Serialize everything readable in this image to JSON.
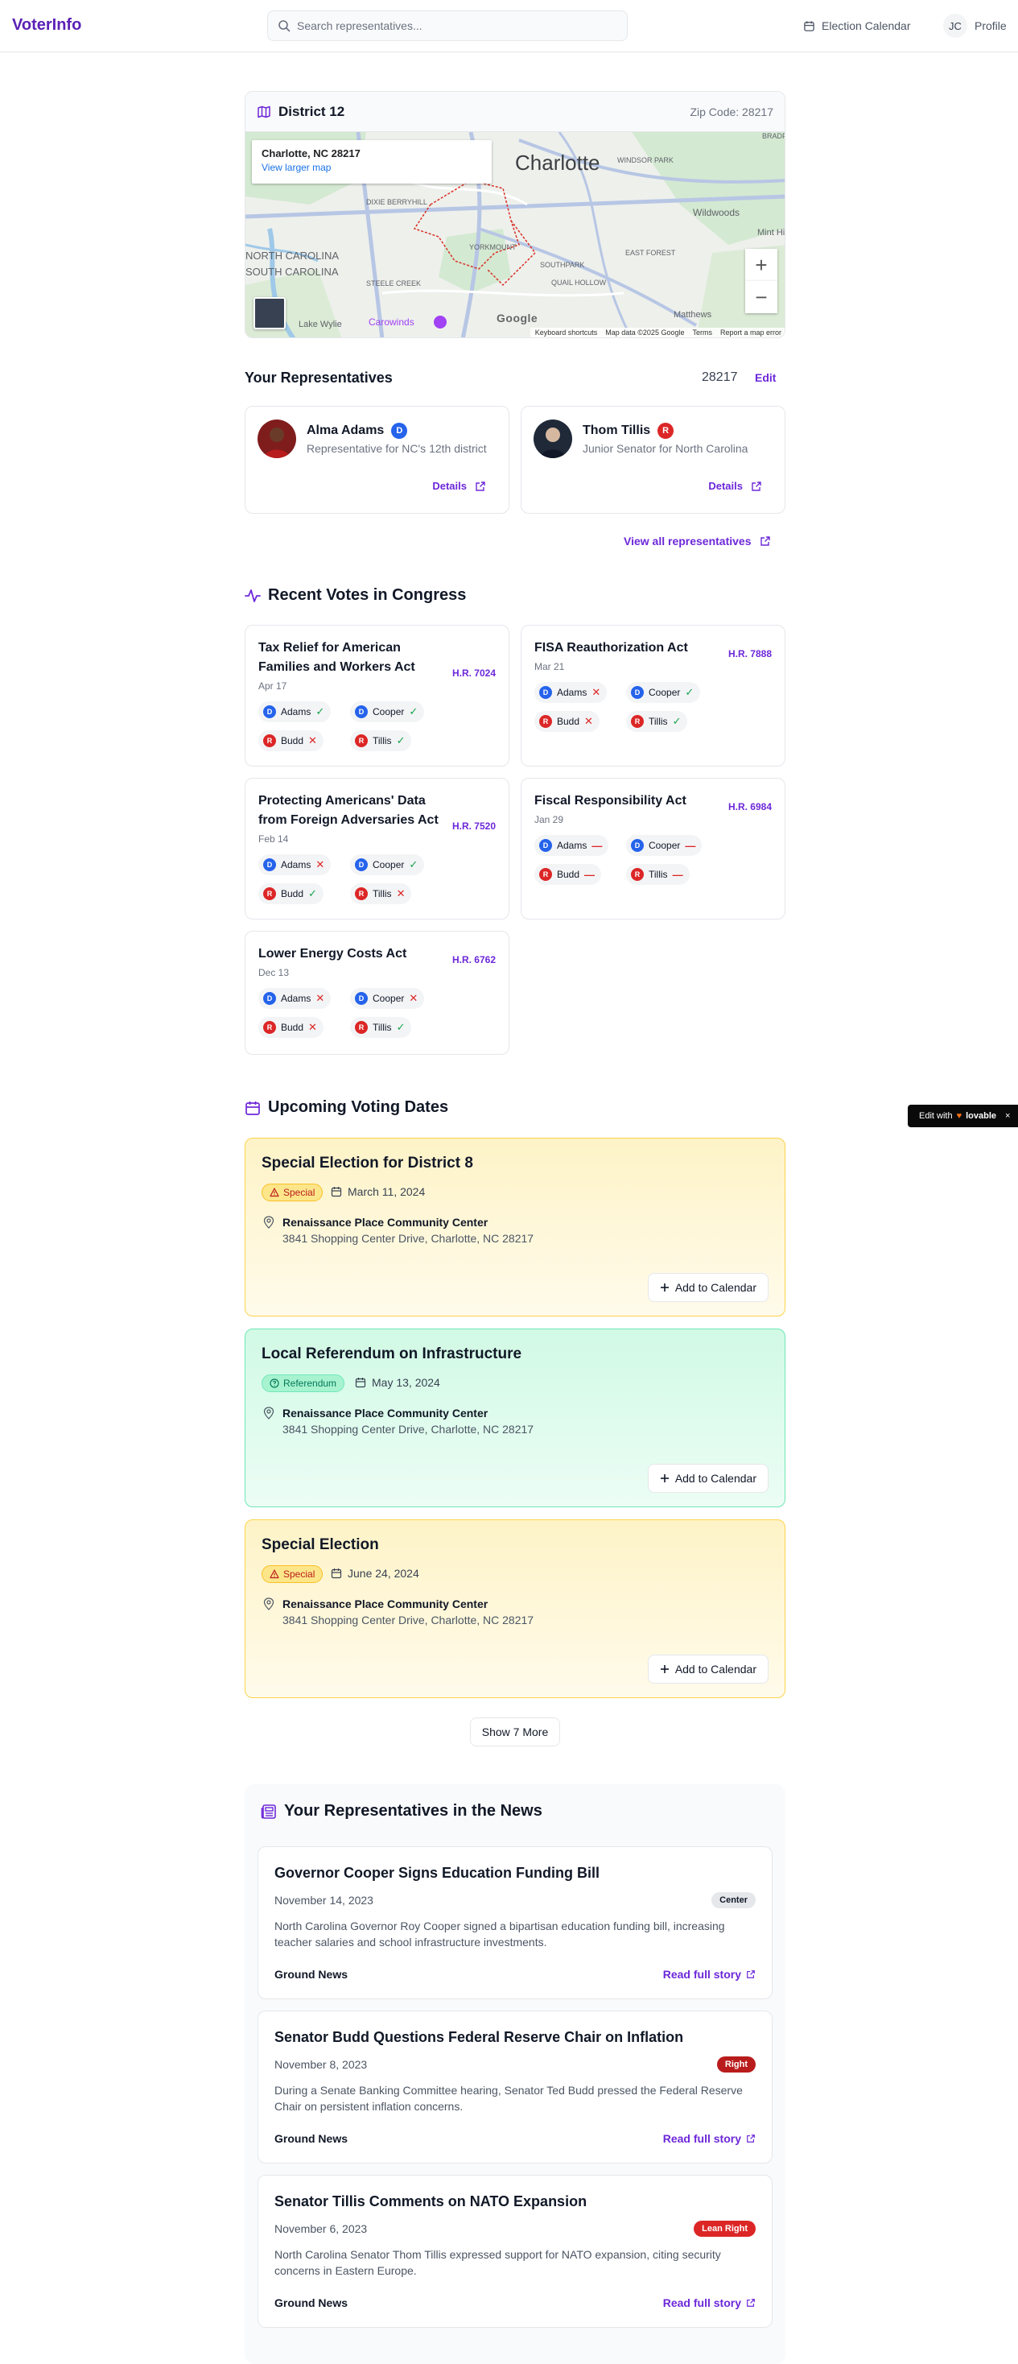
{
  "header": {
    "logo": "VoterInfo",
    "search_placeholder": "Search representatives...",
    "calendar_label": "Election Calendar",
    "profile_initials": "JC",
    "profile_label": "Profile"
  },
  "district": {
    "title": "District 12",
    "zip_label": "Zip Code: 28217",
    "map": {
      "info_title": "Charlotte, NC 28217",
      "info_link": "View larger map",
      "city_label": "Charlotte",
      "place_labels": [
        "WINDSOR PARK",
        "DIXIE BERRYHILL",
        "Wildwoods",
        "YORKMOUNT",
        "EAST FOREST",
        "SOUTHPARK",
        "QUAIL HOLLOW",
        "STEELE CREEK",
        "Matthews",
        "Lake Wylie",
        "Carowinds",
        "NORTH CAROLINA",
        "SOUTH CAROLINA",
        "Mint Hill",
        "BRADF"
      ],
      "zoom_in": "+",
      "zoom_out": "−",
      "attribution": [
        "Keyboard shortcuts",
        "Map data ©2025 Google",
        "Terms",
        "Report a map error"
      ],
      "google_label": "Google"
    }
  },
  "representatives": {
    "title": "Your Representatives",
    "zip": "28217",
    "edit_label": "Edit",
    "items": [
      {
        "name": "Alma Adams",
        "party": "D",
        "role": "Representative for NC's 12th district",
        "details_label": "Details"
      },
      {
        "name": "Thom Tillis",
        "party": "R",
        "role": "Junior Senator for North Carolina",
        "details_label": "Details"
      }
    ],
    "view_all_label": "View all representatives"
  },
  "votes": {
    "title": "Recent Votes in Congress",
    "items": [
      {
        "title": "Tax Relief for American Families and Workers Act",
        "date": "Apr 17",
        "bill": "H.R. 7024",
        "members": [
          {
            "party": "D",
            "name": "Adams",
            "vote": "yes"
          },
          {
            "party": "D",
            "name": "Cooper",
            "vote": "yes"
          },
          {
            "party": "R",
            "name": "Budd",
            "vote": "no"
          },
          {
            "party": "R",
            "name": "Tillis",
            "vote": "yes"
          }
        ]
      },
      {
        "title": "FISA Reauthorization Act",
        "date": "Mar 21",
        "bill": "H.R. 7888",
        "members": [
          {
            "party": "D",
            "name": "Adams",
            "vote": "no"
          },
          {
            "party": "D",
            "name": "Cooper",
            "vote": "yes"
          },
          {
            "party": "R",
            "name": "Budd",
            "vote": "no"
          },
          {
            "party": "R",
            "name": "Tillis",
            "vote": "yes"
          }
        ]
      },
      {
        "title": "Protecting Americans' Data from Foreign Adversaries Act",
        "date": "Feb 14",
        "bill": "H.R. 7520",
        "members": [
          {
            "party": "D",
            "name": "Adams",
            "vote": "no"
          },
          {
            "party": "D",
            "name": "Cooper",
            "vote": "yes"
          },
          {
            "party": "R",
            "name": "Budd",
            "vote": "yes"
          },
          {
            "party": "R",
            "name": "Tillis",
            "vote": "no"
          }
        ]
      },
      {
        "title": "Fiscal Responsibility Act",
        "date": "Jan 29",
        "bill": "H.R. 6984",
        "members": [
          {
            "party": "D",
            "name": "Adams",
            "vote": "na"
          },
          {
            "party": "D",
            "name": "Cooper",
            "vote": "na"
          },
          {
            "party": "R",
            "name": "Budd",
            "vote": "na"
          },
          {
            "party": "R",
            "name": "Tillis",
            "vote": "na"
          }
        ]
      },
      {
        "title": "Lower Energy Costs Act",
        "date": "Dec 13",
        "bill": "H.R. 6762",
        "members": [
          {
            "party": "D",
            "name": "Adams",
            "vote": "no"
          },
          {
            "party": "D",
            "name": "Cooper",
            "vote": "no"
          },
          {
            "party": "R",
            "name": "Budd",
            "vote": "no"
          },
          {
            "party": "R",
            "name": "Tillis",
            "vote": "yes"
          }
        ]
      }
    ]
  },
  "elections": {
    "title": "Upcoming Voting Dates",
    "items": [
      {
        "title": "Special Election for District 8",
        "type": "Special",
        "date": "March 11, 2024",
        "place": "Renaissance Place Community Center",
        "address": "3841 Shopping Center Drive, Charlotte, NC 28217",
        "button": "Add to Calendar"
      },
      {
        "title": "Local Referendum on Infrastructure",
        "type": "Referendum",
        "date": "May 13, 2024",
        "place": "Renaissance Place Community Center",
        "address": "3841 Shopping Center Drive, Charlotte, NC 28217",
        "button": "Add to Calendar"
      },
      {
        "title": "Special Election",
        "type": "Special",
        "date": "June 24, 2024",
        "place": "Renaissance Place Community Center",
        "address": "3841 Shopping Center Drive, Charlotte, NC 28217",
        "button": "Add to Calendar"
      }
    ],
    "show_more_label": "Show 7 More"
  },
  "news": {
    "title": "Your Representatives in the News",
    "items": [
      {
        "title": "Governor Cooper Signs Education Funding Bill",
        "date": "November 14, 2023",
        "bias": "Center",
        "summary": "North Carolina Governor Roy Cooper signed a bipartisan education funding bill, increasing teacher salaries and school infrastructure investments.",
        "source": "Ground News",
        "read_label": "Read full story"
      },
      {
        "title": "Senator Budd Questions Federal Reserve Chair on Inflation",
        "date": "November 8, 2023",
        "bias": "Right",
        "summary": "During a Senate Banking Committee hearing, Senator Ted Budd pressed the Federal Reserve Chair on persistent inflation concerns.",
        "source": "Ground News",
        "read_label": "Read full story"
      },
      {
        "title": "Senator Tillis Comments on NATO Expansion",
        "date": "November 6, 2023",
        "bias": "Lean Right",
        "summary": "North Carolina Senator Thom Tillis expressed support for NATO expansion, citing security concerns in Eastern Europe.",
        "source": "Ground News",
        "read_label": "Read full story"
      }
    ]
  },
  "badge": {
    "prefix": "Edit with",
    "brand": "lovable",
    "close": "×"
  },
  "colors": {
    "accent": "#6d28d9",
    "democrat": "#2563eb",
    "republican": "#dc2626",
    "special_bg": "#fef3c7",
    "referendum_bg": "#d1fae5"
  }
}
